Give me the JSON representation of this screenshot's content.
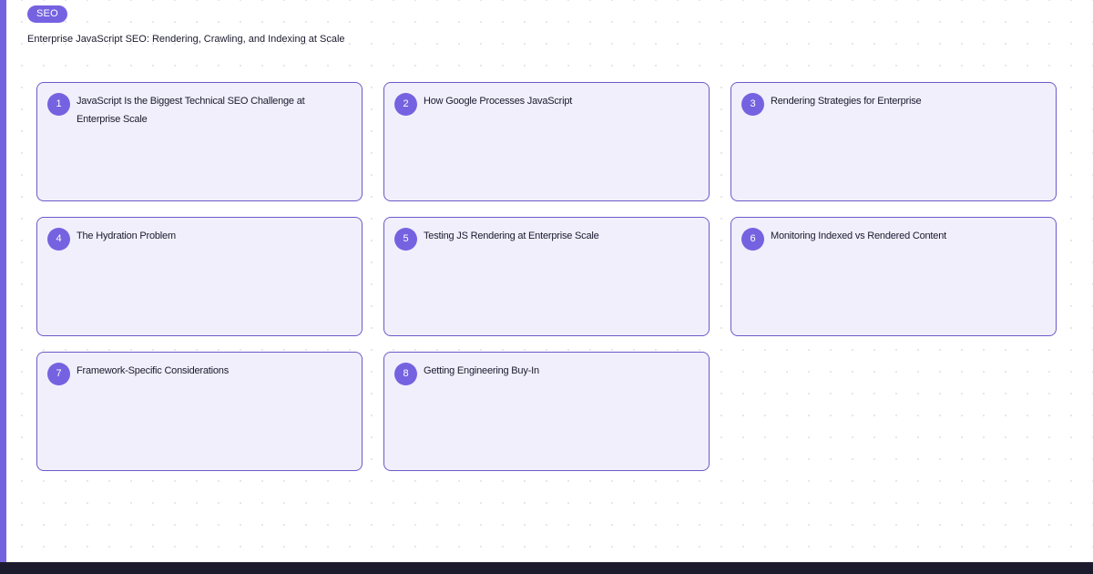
{
  "tag": "SEO",
  "title": "Enterprise JavaScript SEO: Rendering, Crawling, and Indexing at Scale",
  "colors": {
    "accent": "#7562e0",
    "card_background": "#f1effb",
    "card_border": "#6a5bc9",
    "footer": "#1c1b2e"
  },
  "cards": [
    {
      "number": "1",
      "text": "JavaScript Is the Biggest Technical SEO Challenge at Enterprise Scale"
    },
    {
      "number": "2",
      "text": "How Google Processes JavaScript"
    },
    {
      "number": "3",
      "text": "Rendering Strategies for Enterprise"
    },
    {
      "number": "4",
      "text": "The Hydration Problem"
    },
    {
      "number": "5",
      "text": "Testing JS Rendering at Enterprise Scale"
    },
    {
      "number": "6",
      "text": "Monitoring Indexed vs Rendered Content"
    },
    {
      "number": "7",
      "text": "Framework-Specific Considerations"
    },
    {
      "number": "8",
      "text": "Getting Engineering Buy-In"
    }
  ]
}
